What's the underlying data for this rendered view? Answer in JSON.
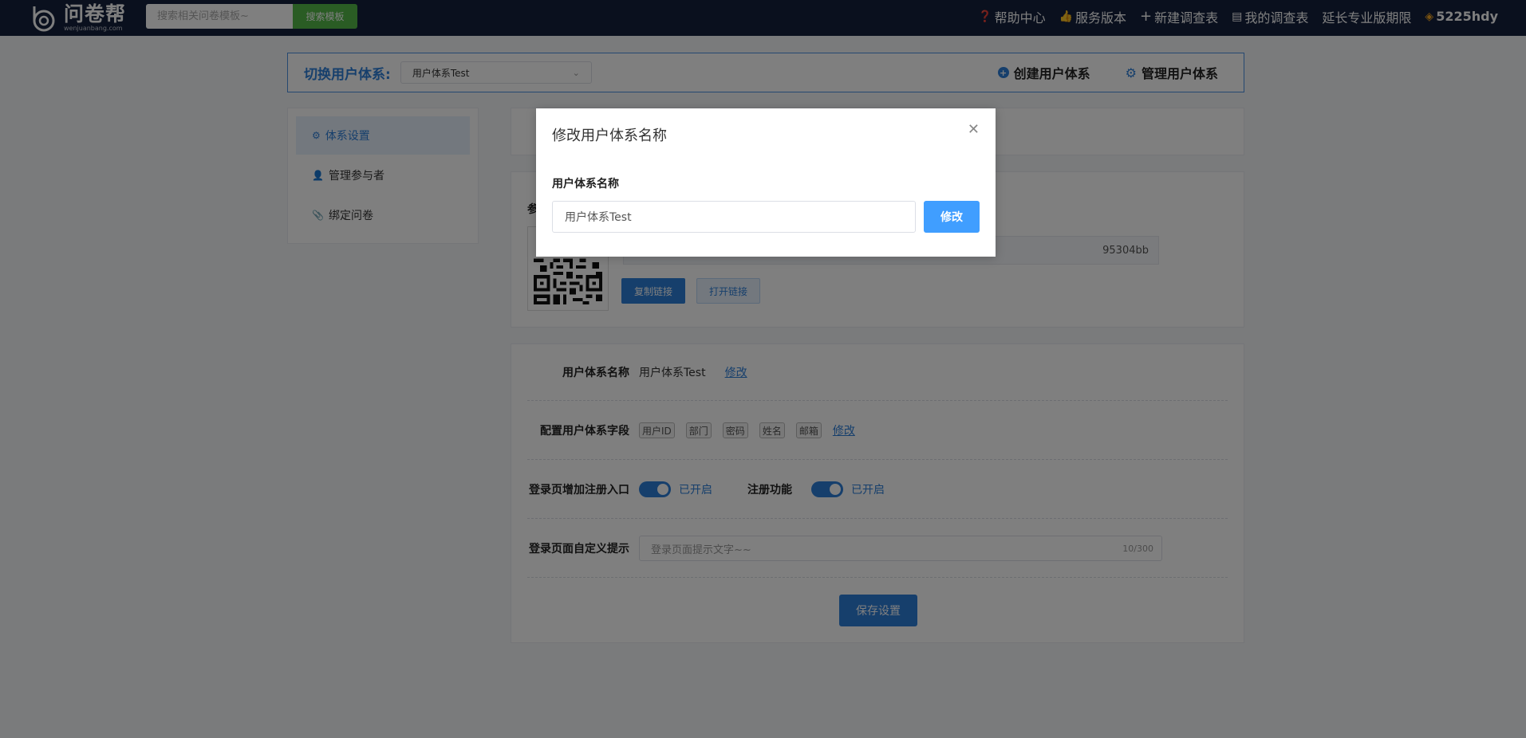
{
  "header": {
    "logo_cn": "问卷帮",
    "logo_en": "wenjuanbang.com",
    "search_placeholder": "搜索相关问卷模板~",
    "search_button": "搜索模板",
    "nav": {
      "help": "帮助中心",
      "service": "服务版本",
      "new_survey": "新建调查表",
      "my_surveys": "我的调查表",
      "extend": "延长专业版期限",
      "username": "5225hdy"
    },
    "icons": {
      "help": "question-circle-icon",
      "service": "thumb-icon",
      "new_survey": "plus-icon",
      "my_surveys": "list-icon",
      "user": "diamond-icon"
    }
  },
  "switchbar": {
    "label": "切换用户体系:",
    "selected": "用户体系Test",
    "create": "创建用户体系",
    "manage": "管理用户体系"
  },
  "sidebar": {
    "items": [
      {
        "label": "体系设置",
        "active": true
      },
      {
        "label": "管理参与者",
        "active": false
      },
      {
        "label": "绑定问卷",
        "active": false
      }
    ]
  },
  "qr_panel": {
    "label": "参",
    "link_suffix": "95304bb",
    "copy_button": "复制链接",
    "open_button": "打开链接"
  },
  "settings": {
    "name_label": "用户体系名称",
    "name_value": "用户体系Test",
    "name_edit": "修改",
    "fields_label": "配置用户体系字段",
    "fields": [
      "用户ID",
      "部门",
      "密码",
      "姓名",
      "邮箱"
    ],
    "fields_edit": "修改",
    "register_entry_label": "登录页增加注册入口",
    "register_entry_state": "已开启",
    "register_label": "注册功能",
    "register_state": "已开启",
    "tip_label": "登录页面自定义提示",
    "tip_value": "登录页面提示文字~~",
    "tip_count": "10/300",
    "save_button": "保存设置"
  },
  "modal": {
    "title": "修改用户体系名称",
    "field_label": "用户体系名称",
    "field_value": "用户体系Test",
    "submit": "修改"
  },
  "colors": {
    "topbar": "#15203c",
    "primary": "#2d7ed9",
    "search_button": "#54b848",
    "modal_button": "#409eff"
  }
}
